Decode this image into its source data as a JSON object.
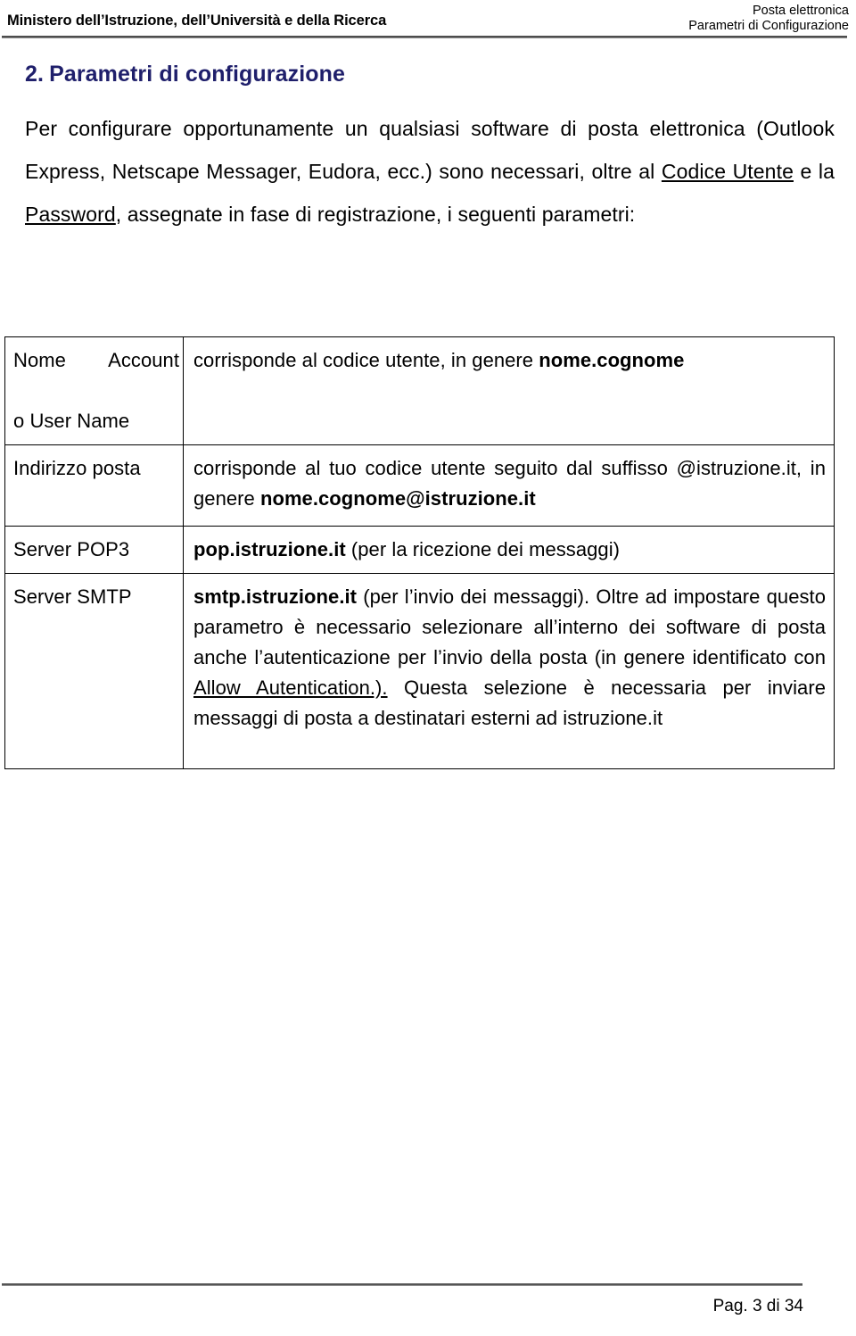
{
  "header": {
    "left_title": "Ministero dell’Istruzione, dell’Università e della Ricerca",
    "right_line1": "Posta elettronica",
    "right_line2": "Parametri di Configurazione",
    "rule_color": "#4d4d4d"
  },
  "section": {
    "number": "2.",
    "title": "Parametri di configurazione",
    "title_color": "#1f1f6b"
  },
  "paragraph": {
    "part1": "Per configurare opportunamente un qualsiasi software di posta elettronica (Outlook Express, Netscape Messager, Eudora, ecc.) sono necessari, oltre al ",
    "link1": "Codice Utente",
    "part2": " e la ",
    "link2": "Password",
    "part3": ", assegnate in fase di registrazione, i seguenti parametri:"
  },
  "table": {
    "rows": [
      {
        "label_line1": "Nome Account",
        "label_line2": "o User Name",
        "value_plain_1": "corrisponde al codice utente, in genere ",
        "value_bold_1": "nome.cognome",
        "value_plain_2": "",
        "value_bold_2": "",
        "value_plain_3": ""
      },
      {
        "label_line1": "Indirizzo posta",
        "label_line2": "",
        "value_plain_1": "corrisponde al tuo codice utente seguito dal suffisso @istruzione.it, in genere ",
        "value_bold_1": "nome.cognome@istruzione.it",
        "value_plain_2": "",
        "value_bold_2": "",
        "value_plain_3": ""
      },
      {
        "label_line1": "Server POP3",
        "label_line2": "",
        "value_bold_lead": "pop.istruzione.it",
        "value_plain_1": " (per la ricezione dei messaggi)",
        "value_plain_2": "",
        "value_underline": "",
        "value_plain_3": ""
      },
      {
        "label_line1": "Server SMTP",
        "label_line2": "",
        "value_bold_lead": "smtp.istruzione.it",
        "value_plain_1": " (per l’invio dei messaggi). Oltre ad impostare questo parametro è necessario selezionare all’interno dei software di posta anche l’autenticazione per l’invio della posta (in genere identificato con ",
        "value_underline": "Allow Autentication.).",
        "value_plain_3": " Questa selezione è necessaria per inviare messaggi di posta a destinatari esterni ad istruzione.it"
      }
    ]
  },
  "footer": {
    "page_text": "Pag. 3 di 34"
  }
}
